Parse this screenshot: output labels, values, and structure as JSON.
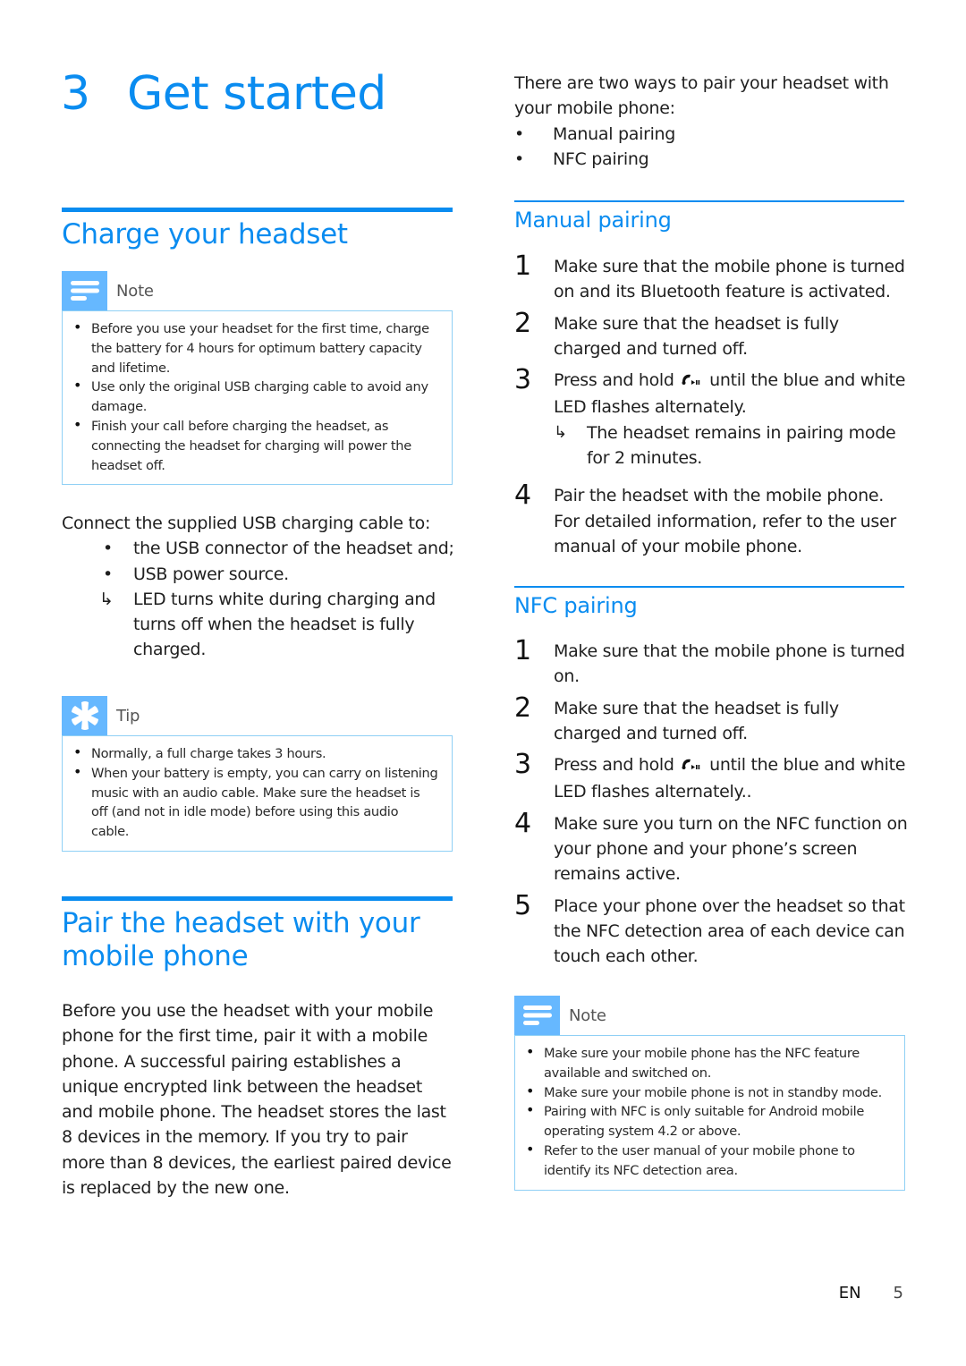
{
  "chapter": {
    "number": "3",
    "title": "Get started"
  },
  "charge": {
    "heading": "Charge your headset",
    "note": {
      "label": "Note",
      "icon": "note-lines-icon",
      "items": [
        "Before you use your headset for the first time, charge the battery for 4 hours for optimum battery capacity and lifetime.",
        "Use only the original USB charging cable to avoid any damage.",
        "Finish your call before charging the headset, as connecting the headset for charging will power the headset off."
      ]
    },
    "intro": "Connect the supplied USB charging cable to:",
    "bullets": [
      "the USB connector of the headset and;",
      "USB power source."
    ],
    "result": "LED turns white during charging and turns off when the headset is fully charged.",
    "tip": {
      "label": "Tip",
      "icon": "asterisk-tip-icon",
      "items": [
        "Normally, a full charge takes 3 hours.",
        "When your battery is empty, you can carry on listening music with an audio cable. Make sure the headset is off (and not in idle mode) before using this audio cable."
      ]
    }
  },
  "pair": {
    "heading_line1": "Pair the headset with your",
    "heading_line2": "mobile phone",
    "body": "Before you use the headset with your mobile phone for the first time, pair it with a mobile phone. A successful pairing establishes a unique encrypted link between the headset and mobile phone. The headset stores the last 8 devices in the memory. If you try to pair more than 8 devices, the earliest paired device is replaced by the new one.",
    "ways_intro": "There are two ways to pair your headset with your mobile phone:",
    "ways": [
      "Manual pairing",
      "NFC pairing"
    ]
  },
  "manual": {
    "heading": "Manual pairing",
    "steps": [
      {
        "num": "1",
        "text": "Make sure that the mobile phone is turned on and its Bluetooth feature is activated."
      },
      {
        "num": "2",
        "text": "Make sure that the headset is fully charged and turned off."
      },
      {
        "num": "3",
        "pre": "Press and hold",
        "post": "until the blue and white LED flashes alternately.",
        "result": "The headset remains in pairing mode for 2 minutes."
      },
      {
        "num": "4",
        "text": "Pair the headset with the mobile phone. For detailed information, refer to the user manual of your mobile phone."
      }
    ]
  },
  "nfc": {
    "heading": "NFC pairing",
    "steps": [
      {
        "num": "1",
        "text": "Make sure that the mobile phone is turned on."
      },
      {
        "num": "2",
        "text": "Make sure that the headset is fully charged and turned off."
      },
      {
        "num": "3",
        "pre": "Press and hold",
        "post": "until the blue and white LED flashes alternately.."
      },
      {
        "num": "4",
        "text": "Make sure you turn on the NFC function on your phone and your phone’s screen remains active."
      },
      {
        "num": "5",
        "text": "Place your phone over the headset so that the NFC detection area of each device can touch each other."
      }
    ],
    "note": {
      "label": "Note",
      "icon": "note-lines-icon",
      "items": [
        "Make sure your mobile phone has the NFC feature available and switched on.",
        "Make sure your mobile phone is not in standby mode.",
        "Pairing with NFC is only suitable for Android mobile operating system 4.2 or above.",
        "Refer to the user manual of your mobile phone to identify its NFC detection area."
      ]
    }
  },
  "symbols": {
    "bullet": "•",
    "result_arrow": "↳"
  },
  "footer": {
    "language": "EN",
    "page": "5"
  },
  "colors": {
    "accent": "#0a8cf0",
    "box_icon_bg": "#66b8ff",
    "box_border": "#8fd0f5"
  }
}
